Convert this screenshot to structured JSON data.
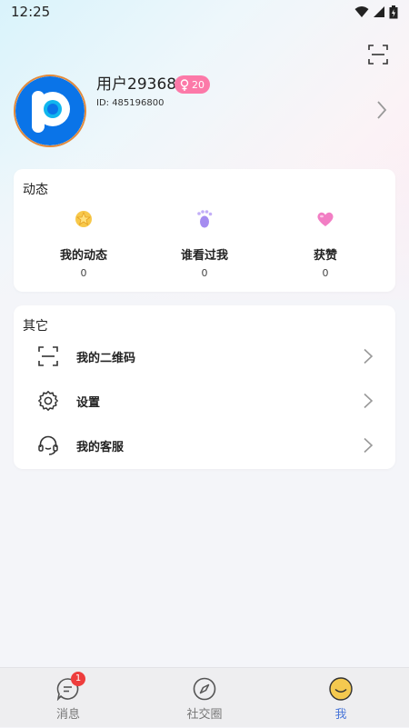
{
  "status_bar": {
    "time": "12:25"
  },
  "profile": {
    "username": "用户29368",
    "gender_age": "20",
    "user_id": "ID: 485196800"
  },
  "dynamics": {
    "title": "动态",
    "items": [
      {
        "label": "我的动态",
        "count": "0",
        "icon": "star-icon"
      },
      {
        "label": "谁看过我",
        "count": "0",
        "icon": "footprint-icon"
      },
      {
        "label": "获赞",
        "count": "0",
        "icon": "heart-icon"
      }
    ]
  },
  "others": {
    "title": "其它",
    "items": [
      {
        "label": "我的二维码",
        "icon": "qr-scan-icon"
      },
      {
        "label": "设置",
        "icon": "gear-icon"
      },
      {
        "label": "我的客服",
        "icon": "headset-icon"
      }
    ]
  },
  "tabbar": {
    "tabs": [
      {
        "label": "消息",
        "badge": "1",
        "icon": "message-icon"
      },
      {
        "label": "社交圈",
        "icon": "compass-icon"
      },
      {
        "label": "我",
        "icon": "smiley-icon",
        "active": true
      }
    ]
  },
  "colors": {
    "accent": "#4a76d8",
    "badge_pink": "#fc79a8",
    "badge_red": "#ee3d3d"
  }
}
